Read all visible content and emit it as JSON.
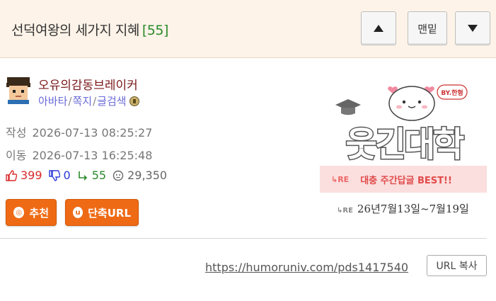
{
  "header": {
    "title": "선덕여왕의 세가지 지혜",
    "comment_count": "[55]",
    "up_icon": "arrow-up-icon",
    "bottom_label": "맨밑",
    "down_icon": "arrow-down-icon"
  },
  "author": {
    "name": "오유의감동브레이커",
    "links": [
      "아바타",
      "쪽지",
      "글검색"
    ],
    "separator": "/",
    "level_icon": "level-badge-icon"
  },
  "meta": {
    "created_label": "작성",
    "created": "2026-07-13 08:25:27",
    "moved_label": "이동",
    "moved": "2026-07-13 16:25:48"
  },
  "stats": {
    "upvotes": "399",
    "downvotes": "0",
    "replies": "55",
    "views": "29,350"
  },
  "buttons": {
    "recommend": "추천",
    "recommend_icon": "◎",
    "short_url": "단축URL",
    "short_url_icon": "u"
  },
  "banner": {
    "by": "BY.한형",
    "logo_text": "웃긴대학",
    "re_tag": "↳RE",
    "strip_text": "대충 주간답글 BEST!!",
    "date_text": "26년7월13일~7월19일"
  },
  "footer": {
    "url": "https://humoruniv.com/pds1417540",
    "copy_label": "URL 복사"
  },
  "colors": {
    "header_bg": "#fdf3e8",
    "accent_orange": "#ef6a14",
    "up_red": "#d82a2a",
    "down_blue": "#2a3ad8",
    "reply_green": "#2a8a2a"
  }
}
